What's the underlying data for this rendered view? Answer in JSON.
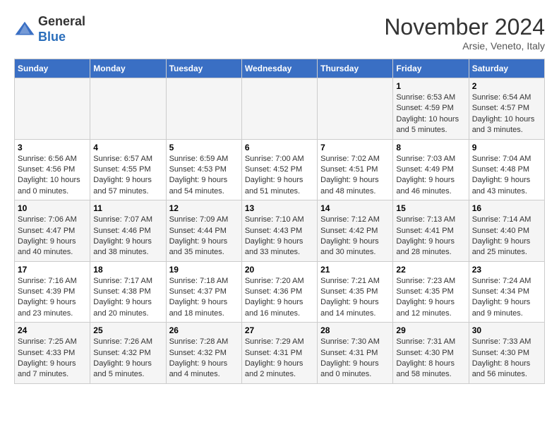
{
  "header": {
    "logo_general": "General",
    "logo_blue": "Blue",
    "month_title": "November 2024",
    "location": "Arsie, Veneto, Italy"
  },
  "columns": [
    "Sunday",
    "Monday",
    "Tuesday",
    "Wednesday",
    "Thursday",
    "Friday",
    "Saturday"
  ],
  "weeks": [
    [
      {
        "day": "",
        "sunrise": "",
        "sunset": "",
        "daylight": ""
      },
      {
        "day": "",
        "sunrise": "",
        "sunset": "",
        "daylight": ""
      },
      {
        "day": "",
        "sunrise": "",
        "sunset": "",
        "daylight": ""
      },
      {
        "day": "",
        "sunrise": "",
        "sunset": "",
        "daylight": ""
      },
      {
        "day": "",
        "sunrise": "",
        "sunset": "",
        "daylight": ""
      },
      {
        "day": "1",
        "sunrise": "Sunrise: 6:53 AM",
        "sunset": "Sunset: 4:59 PM",
        "daylight": "Daylight: 10 hours and 5 minutes."
      },
      {
        "day": "2",
        "sunrise": "Sunrise: 6:54 AM",
        "sunset": "Sunset: 4:57 PM",
        "daylight": "Daylight: 10 hours and 3 minutes."
      }
    ],
    [
      {
        "day": "3",
        "sunrise": "Sunrise: 6:56 AM",
        "sunset": "Sunset: 4:56 PM",
        "daylight": "Daylight: 10 hours and 0 minutes."
      },
      {
        "day": "4",
        "sunrise": "Sunrise: 6:57 AM",
        "sunset": "Sunset: 4:55 PM",
        "daylight": "Daylight: 9 hours and 57 minutes."
      },
      {
        "day": "5",
        "sunrise": "Sunrise: 6:59 AM",
        "sunset": "Sunset: 4:53 PM",
        "daylight": "Daylight: 9 hours and 54 minutes."
      },
      {
        "day": "6",
        "sunrise": "Sunrise: 7:00 AM",
        "sunset": "Sunset: 4:52 PM",
        "daylight": "Daylight: 9 hours and 51 minutes."
      },
      {
        "day": "7",
        "sunrise": "Sunrise: 7:02 AM",
        "sunset": "Sunset: 4:51 PM",
        "daylight": "Daylight: 9 hours and 48 minutes."
      },
      {
        "day": "8",
        "sunrise": "Sunrise: 7:03 AM",
        "sunset": "Sunset: 4:49 PM",
        "daylight": "Daylight: 9 hours and 46 minutes."
      },
      {
        "day": "9",
        "sunrise": "Sunrise: 7:04 AM",
        "sunset": "Sunset: 4:48 PM",
        "daylight": "Daylight: 9 hours and 43 minutes."
      }
    ],
    [
      {
        "day": "10",
        "sunrise": "Sunrise: 7:06 AM",
        "sunset": "Sunset: 4:47 PM",
        "daylight": "Daylight: 9 hours and 40 minutes."
      },
      {
        "day": "11",
        "sunrise": "Sunrise: 7:07 AM",
        "sunset": "Sunset: 4:46 PM",
        "daylight": "Daylight: 9 hours and 38 minutes."
      },
      {
        "day": "12",
        "sunrise": "Sunrise: 7:09 AM",
        "sunset": "Sunset: 4:44 PM",
        "daylight": "Daylight: 9 hours and 35 minutes."
      },
      {
        "day": "13",
        "sunrise": "Sunrise: 7:10 AM",
        "sunset": "Sunset: 4:43 PM",
        "daylight": "Daylight: 9 hours and 33 minutes."
      },
      {
        "day": "14",
        "sunrise": "Sunrise: 7:12 AM",
        "sunset": "Sunset: 4:42 PM",
        "daylight": "Daylight: 9 hours and 30 minutes."
      },
      {
        "day": "15",
        "sunrise": "Sunrise: 7:13 AM",
        "sunset": "Sunset: 4:41 PM",
        "daylight": "Daylight: 9 hours and 28 minutes."
      },
      {
        "day": "16",
        "sunrise": "Sunrise: 7:14 AM",
        "sunset": "Sunset: 4:40 PM",
        "daylight": "Daylight: 9 hours and 25 minutes."
      }
    ],
    [
      {
        "day": "17",
        "sunrise": "Sunrise: 7:16 AM",
        "sunset": "Sunset: 4:39 PM",
        "daylight": "Daylight: 9 hours and 23 minutes."
      },
      {
        "day": "18",
        "sunrise": "Sunrise: 7:17 AM",
        "sunset": "Sunset: 4:38 PM",
        "daylight": "Daylight: 9 hours and 20 minutes."
      },
      {
        "day": "19",
        "sunrise": "Sunrise: 7:18 AM",
        "sunset": "Sunset: 4:37 PM",
        "daylight": "Daylight: 9 hours and 18 minutes."
      },
      {
        "day": "20",
        "sunrise": "Sunrise: 7:20 AM",
        "sunset": "Sunset: 4:36 PM",
        "daylight": "Daylight: 9 hours and 16 minutes."
      },
      {
        "day": "21",
        "sunrise": "Sunrise: 7:21 AM",
        "sunset": "Sunset: 4:35 PM",
        "daylight": "Daylight: 9 hours and 14 minutes."
      },
      {
        "day": "22",
        "sunrise": "Sunrise: 7:23 AM",
        "sunset": "Sunset: 4:35 PM",
        "daylight": "Daylight: 9 hours and 12 minutes."
      },
      {
        "day": "23",
        "sunrise": "Sunrise: 7:24 AM",
        "sunset": "Sunset: 4:34 PM",
        "daylight": "Daylight: 9 hours and 9 minutes."
      }
    ],
    [
      {
        "day": "24",
        "sunrise": "Sunrise: 7:25 AM",
        "sunset": "Sunset: 4:33 PM",
        "daylight": "Daylight: 9 hours and 7 minutes."
      },
      {
        "day": "25",
        "sunrise": "Sunrise: 7:26 AM",
        "sunset": "Sunset: 4:32 PM",
        "daylight": "Daylight: 9 hours and 5 minutes."
      },
      {
        "day": "26",
        "sunrise": "Sunrise: 7:28 AM",
        "sunset": "Sunset: 4:32 PM",
        "daylight": "Daylight: 9 hours and 4 minutes."
      },
      {
        "day": "27",
        "sunrise": "Sunrise: 7:29 AM",
        "sunset": "Sunset: 4:31 PM",
        "daylight": "Daylight: 9 hours and 2 minutes."
      },
      {
        "day": "28",
        "sunrise": "Sunrise: 7:30 AM",
        "sunset": "Sunset: 4:31 PM",
        "daylight": "Daylight: 9 hours and 0 minutes."
      },
      {
        "day": "29",
        "sunrise": "Sunrise: 7:31 AM",
        "sunset": "Sunset: 4:30 PM",
        "daylight": "Daylight: 8 hours and 58 minutes."
      },
      {
        "day": "30",
        "sunrise": "Sunrise: 7:33 AM",
        "sunset": "Sunset: 4:30 PM",
        "daylight": "Daylight: 8 hours and 56 minutes."
      }
    ]
  ]
}
